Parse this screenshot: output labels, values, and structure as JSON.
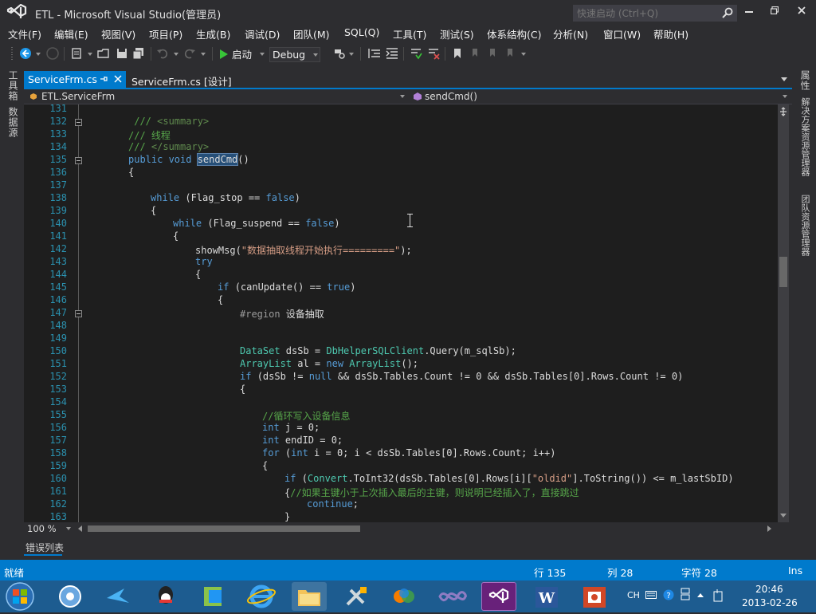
{
  "window": {
    "title": "ETL - Microsoft Visual Studio(管理员)",
    "quick_launch_placeholder": "快速启动 (Ctrl+Q)"
  },
  "menu": [
    "文件(F)",
    "编辑(E)",
    "视图(V)",
    "项目(P)",
    "生成(B)",
    "调试(D)",
    "团队(M)",
    "SQL(Q)",
    "工具(T)",
    "测试(S)",
    "体系结构(C)",
    "分析(N)",
    "窗口(W)",
    "帮助(H)"
  ],
  "toolbar": {
    "start_label": "启动",
    "config_value": "Debug"
  },
  "left_rail": [
    "工具箱",
    "数据源"
  ],
  "right_rail": [
    "属性",
    "解决方案资源管理器",
    "团队资源管理器"
  ],
  "tabs": [
    {
      "label": "ServiceFrm.cs",
      "active": true
    },
    {
      "label": "ServiceFrm.cs [设计]",
      "active": false
    }
  ],
  "navbar": {
    "class_value": "ETL.ServiceFrm",
    "member_value": "sendCmd()"
  },
  "code_lines": [
    {
      "n": "131",
      "indent": 0,
      "tokens": []
    },
    {
      "n": "132",
      "indent": 2,
      "fold": true,
      "tokens": [
        {
          "t": " /// ",
          "c": "cm"
        },
        {
          "t": "<summary>",
          "c": "doc"
        }
      ]
    },
    {
      "n": "133",
      "indent": 2,
      "tokens": [
        {
          "t": "/// 线程",
          "c": "cm"
        }
      ]
    },
    {
      "n": "134",
      "indent": 2,
      "tokens": [
        {
          "t": "/// ",
          "c": "cm"
        },
        {
          "t": "</summary>",
          "c": "doc"
        }
      ]
    },
    {
      "n": "135",
      "indent": 2,
      "fold": true,
      "tokens": [
        {
          "t": "public void ",
          "c": "kw"
        },
        {
          "t": "sendCmd",
          "c": "sel"
        },
        {
          "t": "()",
          "c": "tx"
        }
      ]
    },
    {
      "n": "136",
      "indent": 2,
      "tokens": [
        {
          "t": "{",
          "c": "tx"
        }
      ]
    },
    {
      "n": "137",
      "indent": 0,
      "tokens": []
    },
    {
      "n": "138",
      "indent": 4,
      "tokens": [
        {
          "t": "while ",
          "c": "kw"
        },
        {
          "t": "(Flag_stop == ",
          "c": "tx"
        },
        {
          "t": "false",
          "c": "kw"
        },
        {
          "t": ")",
          "c": "tx"
        }
      ]
    },
    {
      "n": "139",
      "indent": 4,
      "tokens": [
        {
          "t": "{",
          "c": "tx"
        }
      ]
    },
    {
      "n": "140",
      "indent": 6,
      "tokens": [
        {
          "t": "while ",
          "c": "kw"
        },
        {
          "t": "(Flag_suspend == ",
          "c": "tx"
        },
        {
          "t": "false",
          "c": "kw"
        },
        {
          "t": ")",
          "c": "tx"
        }
      ]
    },
    {
      "n": "141",
      "indent": 6,
      "tokens": [
        {
          "t": "{",
          "c": "tx"
        }
      ]
    },
    {
      "n": "142",
      "indent": 8,
      "tokens": [
        {
          "t": "showMsg(",
          "c": "tx"
        },
        {
          "t": "\"数据抽取线程开始执行=========\"",
          "c": "str"
        },
        {
          "t": ");",
          "c": "tx"
        }
      ]
    },
    {
      "n": "143",
      "indent": 8,
      "tokens": [
        {
          "t": "try",
          "c": "kw"
        }
      ]
    },
    {
      "n": "144",
      "indent": 8,
      "tokens": [
        {
          "t": "{",
          "c": "tx"
        }
      ]
    },
    {
      "n": "145",
      "indent": 10,
      "tokens": [
        {
          "t": "if ",
          "c": "kw"
        },
        {
          "t": "(canUpdate() == ",
          "c": "tx"
        },
        {
          "t": "true",
          "c": "kw"
        },
        {
          "t": ")",
          "c": "tx"
        }
      ]
    },
    {
      "n": "146",
      "indent": 10,
      "tokens": [
        {
          "t": "{",
          "c": "tx"
        }
      ]
    },
    {
      "n": "147",
      "indent": 12,
      "fold": true,
      "tokens": [
        {
          "t": "#region ",
          "c": "pp"
        },
        {
          "t": "设备抽取",
          "c": "tx"
        }
      ]
    },
    {
      "n": "148",
      "indent": 0,
      "tokens": []
    },
    {
      "n": "149",
      "indent": 0,
      "tokens": []
    },
    {
      "n": "150",
      "indent": 12,
      "tokens": [
        {
          "t": "DataSet ",
          "c": "ty"
        },
        {
          "t": "dsSb = ",
          "c": "tx"
        },
        {
          "t": "DbHelperSQLClient",
          "c": "ty"
        },
        {
          "t": ".Query(m_sqlSb);",
          "c": "tx"
        }
      ]
    },
    {
      "n": "151",
      "indent": 12,
      "tokens": [
        {
          "t": "ArrayList ",
          "c": "ty"
        },
        {
          "t": "al = ",
          "c": "tx"
        },
        {
          "t": "new ",
          "c": "kw"
        },
        {
          "t": "ArrayList",
          "c": "ty"
        },
        {
          "t": "();",
          "c": "tx"
        }
      ]
    },
    {
      "n": "152",
      "indent": 12,
      "tokens": [
        {
          "t": "if ",
          "c": "kw"
        },
        {
          "t": "(dsSb != ",
          "c": "tx"
        },
        {
          "t": "null ",
          "c": "kw"
        },
        {
          "t": "&& dsSb.Tables.Count != 0 && dsSb.Tables[0].Rows.Count != 0)",
          "c": "tx"
        }
      ]
    },
    {
      "n": "153",
      "indent": 12,
      "tokens": [
        {
          "t": "{",
          "c": "tx"
        }
      ]
    },
    {
      "n": "154",
      "indent": 0,
      "tokens": []
    },
    {
      "n": "155",
      "indent": 14,
      "tokens": [
        {
          "t": "//循环写入设备信息",
          "c": "cm"
        }
      ]
    },
    {
      "n": "156",
      "indent": 14,
      "tokens": [
        {
          "t": "int ",
          "c": "kw"
        },
        {
          "t": "j = 0;",
          "c": "tx"
        }
      ]
    },
    {
      "n": "157",
      "indent": 14,
      "tokens": [
        {
          "t": "int ",
          "c": "kw"
        },
        {
          "t": "endID = 0;",
          "c": "tx"
        }
      ]
    },
    {
      "n": "158",
      "indent": 14,
      "tokens": [
        {
          "t": "for ",
          "c": "kw"
        },
        {
          "t": "(",
          "c": "tx"
        },
        {
          "t": "int ",
          "c": "kw"
        },
        {
          "t": "i = 0; i < dsSb.Tables[0].Rows.Count; i++)",
          "c": "tx"
        }
      ]
    },
    {
      "n": "159",
      "indent": 14,
      "tokens": [
        {
          "t": "{",
          "c": "tx"
        }
      ]
    },
    {
      "n": "160",
      "indent": 16,
      "tokens": [
        {
          "t": "if ",
          "c": "kw"
        },
        {
          "t": "(",
          "c": "tx"
        },
        {
          "t": "Convert",
          "c": "ty"
        },
        {
          "t": ".ToInt32(dsSb.Tables[0].Rows[i][",
          "c": "tx"
        },
        {
          "t": "\"oldid\"",
          "c": "str"
        },
        {
          "t": "].ToString()) <= m_lastSbID)",
          "c": "tx"
        }
      ]
    },
    {
      "n": "161",
      "indent": 16,
      "tokens": [
        {
          "t": "{",
          "c": "tx"
        },
        {
          "t": "//如果主键小于上次插入最后的主键，则说明已经插入了，直接跳过",
          "c": "cm"
        }
      ]
    },
    {
      "n": "162",
      "indent": 18,
      "tokens": [
        {
          "t": "continue",
          "c": "kw"
        },
        {
          "t": ";",
          "c": "tx"
        }
      ]
    },
    {
      "n": "163",
      "indent": 16,
      "tokens": [
        {
          "t": "}",
          "c": "tx"
        }
      ]
    }
  ],
  "zoom": "100 %",
  "error_panel_label": "错误列表",
  "status": {
    "ready": "就绪",
    "line": "行 135",
    "col": "列 28",
    "char": "字符 28",
    "mode": "Ins"
  },
  "tray": {
    "ime": "CH",
    "time": "20:46",
    "date": "2013-02-26"
  },
  "colors": {
    "kw": "#569cd6",
    "cm": "#57a64a",
    "doc": "#608b4e",
    "str": "#d69d85",
    "ty": "#4ec9b0",
    "pp": "#9b9b9b",
    "tx": "#dcdcdc",
    "accent": "#007acc"
  }
}
